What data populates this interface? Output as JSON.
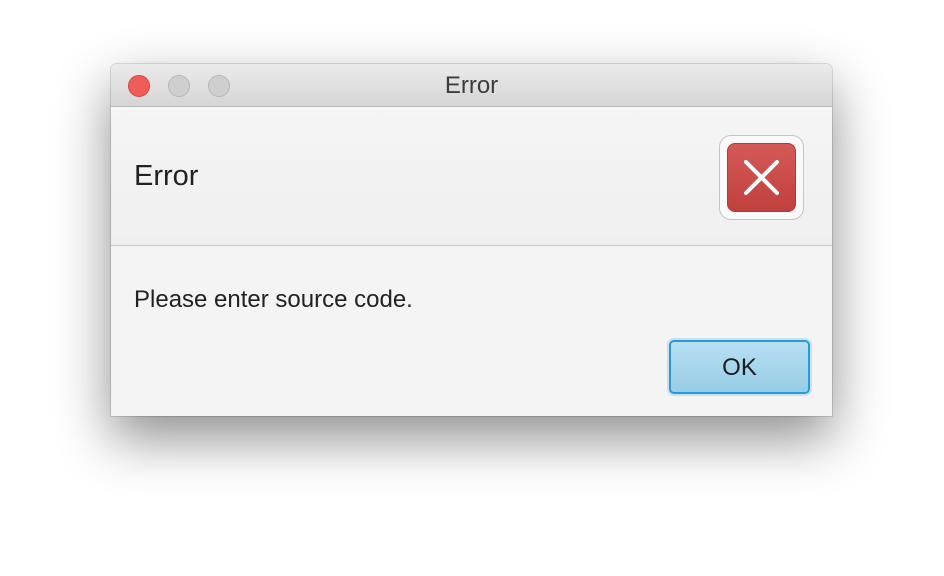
{
  "window": {
    "title": "Error"
  },
  "dialog": {
    "header_text": "Error",
    "content_text": "Please enter source code.",
    "ok_label": "OK"
  },
  "icons": {
    "header_icon": "error-x-icon",
    "close": "close-icon",
    "minimize": "minimize-icon",
    "zoom": "zoom-icon"
  },
  "colors": {
    "close_button": "#ee5e57",
    "inactive_traffic_light": "#cfcfcf",
    "error_icon_background": "#c94a47",
    "ok_button_background": "#a9d8ee",
    "ok_button_border": "#2a9bd2"
  }
}
